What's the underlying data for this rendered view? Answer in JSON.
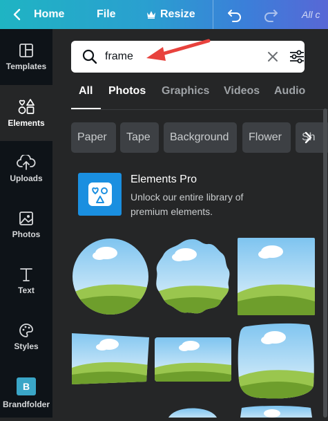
{
  "topbar": {
    "back_icon": "chevron-left-icon",
    "home_label": "Home",
    "file_label": "File",
    "resize_icon": "crown-icon",
    "resize_label": "Resize",
    "undo_icon": "undo-icon",
    "redo_icon": "redo-icon",
    "saved_label": "All c"
  },
  "sidebar": {
    "items": [
      {
        "label": "Templates",
        "icon": "templates-icon"
      },
      {
        "label": "Elements",
        "icon": "elements-icon",
        "active": true
      },
      {
        "label": "Uploads",
        "icon": "cloud-upload-icon"
      },
      {
        "label": "Photos",
        "icon": "image-icon"
      },
      {
        "label": "Text",
        "icon": "text-icon"
      },
      {
        "label": "Styles",
        "icon": "palette-icon"
      },
      {
        "label": "Brandfolder",
        "icon": "brandfolder-icon",
        "icon_letter": "B"
      }
    ]
  },
  "search": {
    "value": "frame",
    "search_icon": "search-icon",
    "clear_icon": "close-icon",
    "filter_icon": "sliders-icon"
  },
  "tabs": [
    {
      "label": "All",
      "active": true
    },
    {
      "label": "Photos"
    },
    {
      "label": "Graphics"
    },
    {
      "label": "Videos"
    },
    {
      "label": "Audio"
    }
  ],
  "chips": [
    "Paper",
    "Tape",
    "Background",
    "Flower",
    "Sh"
  ],
  "promo": {
    "title": "Elements Pro",
    "description": "Unlock our entire library of premium elements."
  },
  "colors": {
    "accent_arrow": "#e8423d",
    "sky": "#9fd2f3",
    "grass": "#7fb23a"
  }
}
